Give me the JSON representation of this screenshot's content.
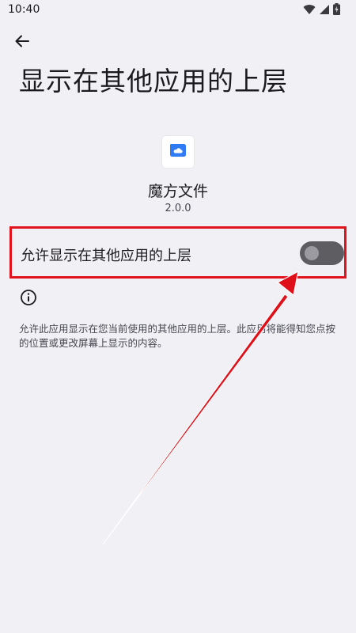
{
  "status_bar": {
    "time": "10:40"
  },
  "header": {
    "title": "显示在其他应用的上层"
  },
  "app": {
    "name": "魔方文件",
    "version": "2.0.0",
    "icon": "folder-cloud-icon"
  },
  "permission": {
    "label": "允许显示在其他应用的上层",
    "enabled": false
  },
  "description": "允许此应用显示在您当前使用的其他应用的上层。此应用将能得知您点按的位置或更改屏幕上显示的内容。",
  "colors": {
    "background": "#f1f0f5",
    "highlight_box": "#e1141e",
    "toggle_track": "#5e5e62",
    "app_icon_accent": "#2f7bf5"
  }
}
